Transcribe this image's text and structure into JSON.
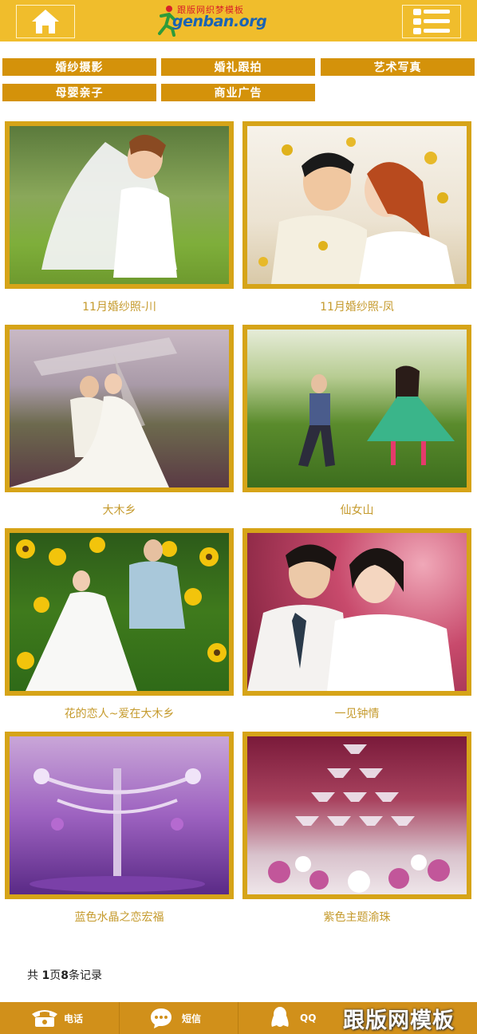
{
  "header": {
    "logo_top": "跟版网织梦模板",
    "logo_main": "genban.org",
    "home_icon": "home-icon",
    "menu_icon": "menu-icon"
  },
  "categories": [
    {
      "label": "婚纱摄影"
    },
    {
      "label": "婚礼跟拍"
    },
    {
      "label": "艺术写真"
    },
    {
      "label": "母婴亲子"
    },
    {
      "label": "商业广告"
    }
  ],
  "gallery": [
    {
      "caption": "11月婚纱照-川",
      "scene": "green-field"
    },
    {
      "caption": "11月婚纱照-凤",
      "scene": "autumn-leaves"
    },
    {
      "caption": "大木乡",
      "scene": "windmill"
    },
    {
      "caption": "仙女山",
      "scene": "meadow"
    },
    {
      "caption": "花的恋人~爱在大木乡",
      "scene": "sunflowers"
    },
    {
      "caption": "一见钟情",
      "scene": "blossom"
    },
    {
      "caption": "蓝色水晶之恋宏福",
      "scene": "purple-crystal"
    },
    {
      "caption": "紫色主题渝珠",
      "scene": "champagne-tower"
    }
  ],
  "pager": {
    "prefix": "共 ",
    "pages": "1",
    "mid": "页",
    "count": "8",
    "suffix": "条记录"
  },
  "footer": {
    "phone_label": "电话",
    "sms_label": "短信",
    "qq_label": "QQ",
    "watermark": "跟版网模板"
  },
  "colors": {
    "accent": "#f0bd2c",
    "category": "#d4920a",
    "frame": "#d6a418",
    "caption": "#c59a2c",
    "footer": "#d1901a"
  }
}
